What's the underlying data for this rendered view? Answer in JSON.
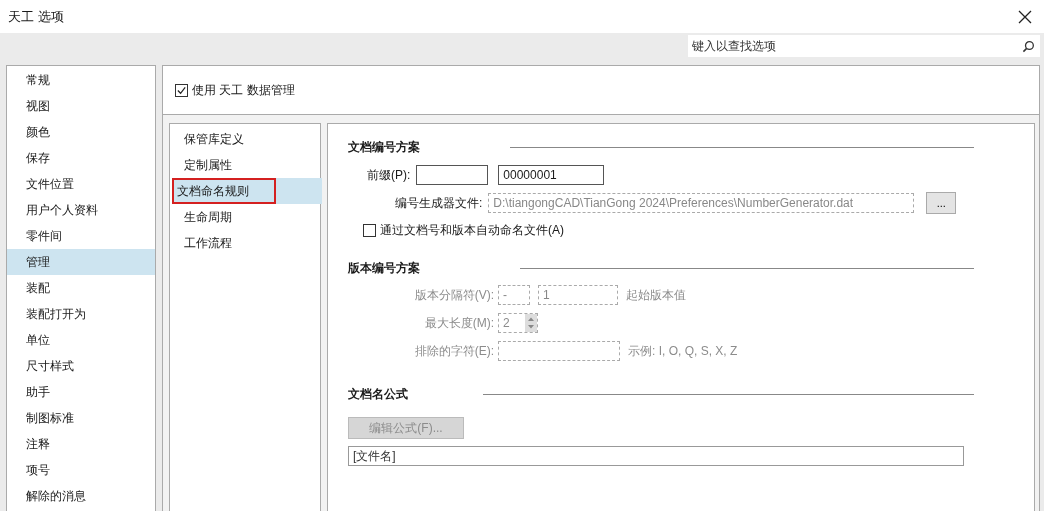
{
  "window": {
    "title": "天工 选项"
  },
  "search": {
    "placeholder": "键入以查找选项"
  },
  "categories": [
    {
      "label": "常规",
      "selected": false
    },
    {
      "label": "视图",
      "selected": false
    },
    {
      "label": "颜色",
      "selected": false
    },
    {
      "label": "保存",
      "selected": false
    },
    {
      "label": "文件位置",
      "selected": false
    },
    {
      "label": "用户个人资料",
      "selected": false
    },
    {
      "label": "零件间",
      "selected": false
    },
    {
      "label": "管理",
      "selected": true
    },
    {
      "label": "装配",
      "selected": false
    },
    {
      "label": "装配打开为",
      "selected": false
    },
    {
      "label": "单位",
      "selected": false
    },
    {
      "label": "尺寸样式",
      "selected": false
    },
    {
      "label": "助手",
      "selected": false
    },
    {
      "label": "制图标准",
      "selected": false
    },
    {
      "label": "注释",
      "selected": false
    },
    {
      "label": "项号",
      "selected": false
    },
    {
      "label": "解除的消息",
      "selected": false
    }
  ],
  "data_management": {
    "label": "使用 天工 数据管理",
    "checked": true
  },
  "subpages": [
    {
      "label": "保管库定义",
      "selected": false
    },
    {
      "label": "定制属性",
      "selected": false
    },
    {
      "label": "文档命名规则",
      "selected": true
    },
    {
      "label": "生命周期",
      "selected": false
    },
    {
      "label": "工作流程",
      "selected": false
    }
  ],
  "document_numbering": {
    "heading": "文档编号方案",
    "prefix_label": "前缀(P):",
    "number_value": "00000001",
    "generator_label": "编号生成器文件:",
    "generator_path": "D:\\tiangongCAD\\TianGong 2024\\Preferences\\NumberGenerator.dat",
    "browse_button": "...",
    "auto_name": {
      "label": "通过文档号和版本自动命名文件(A)",
      "checked": false
    }
  },
  "version_numbering": {
    "heading": "版本编号方案",
    "disabled": true,
    "separator_label": "版本分隔符(V):",
    "separator_value": "-",
    "start_value": "1",
    "start_label": "起始版本值",
    "max_length_label": "最大长度(M):",
    "max_length_value": "2",
    "excluded_label": "排除的字符(E):",
    "example": "示例: I, O, Q, S, X, Z"
  },
  "name_formula": {
    "heading": "文档名公式",
    "edit_button": {
      "label": "编辑公式(F)...",
      "disabled": true
    },
    "formula": "[文件名]"
  }
}
